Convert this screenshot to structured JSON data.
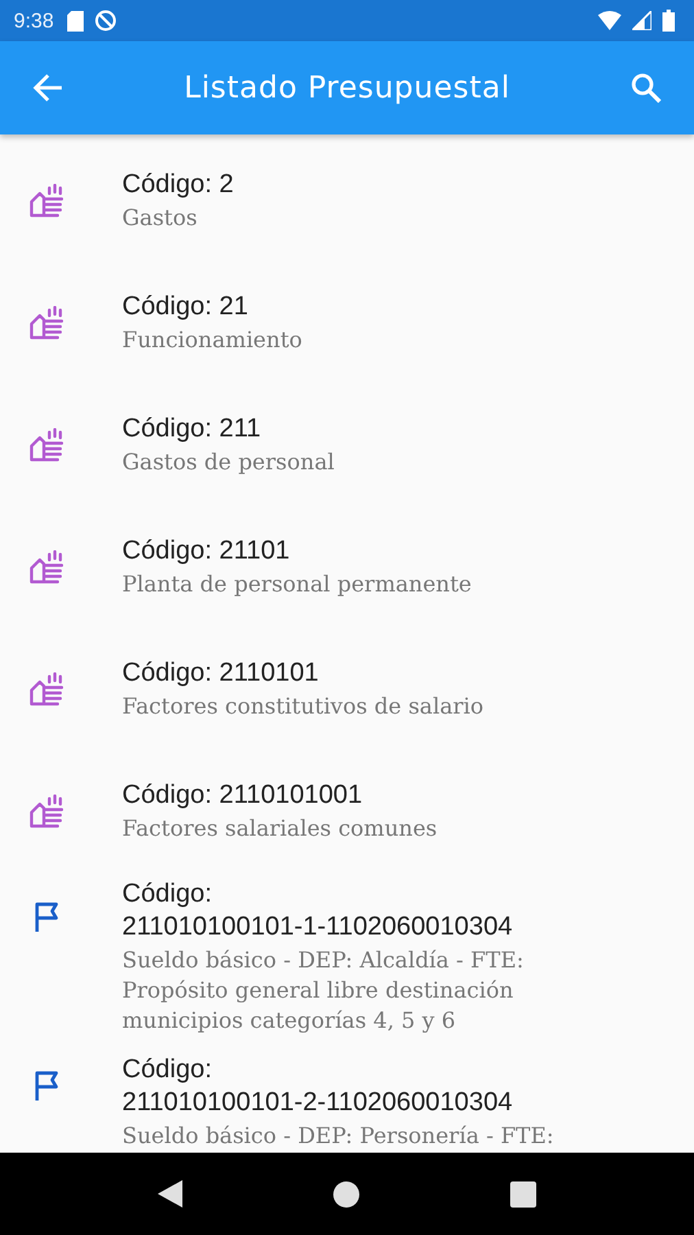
{
  "status_bar": {
    "time": "9:38"
  },
  "app_bar": {
    "title": "Listado Presupuestal"
  },
  "items": [
    {
      "kind": "group",
      "label": "Código:",
      "code": "2",
      "subtitle": "Gastos"
    },
    {
      "kind": "group",
      "label": "Código:",
      "code": "21",
      "subtitle": "Funcionamiento"
    },
    {
      "kind": "group",
      "label": "Código:",
      "code": "211",
      "subtitle": "Gastos de personal"
    },
    {
      "kind": "group",
      "label": "Código:",
      "code": "21101",
      "subtitle": "Planta de personal permanente"
    },
    {
      "kind": "group",
      "label": "Código:",
      "code": "2110101",
      "subtitle": "Factores constitutivos de salario"
    },
    {
      "kind": "group",
      "label": "Código:",
      "code": "2110101001",
      "subtitle": "Factores salariales comunes"
    },
    {
      "kind": "leaf",
      "label": "Código:",
      "code": "211010100101-1-1102060010304",
      "subtitle": "Sueldo básico - DEP: Alcaldía - FTE: Propósito general libre destinación municipios categorías 4, 5 y 6"
    },
    {
      "kind": "leaf",
      "label": "Código:",
      "code": "211010100101-2-1102060010304",
      "subtitle": "Sueldo básico - DEP: Personería - FTE:"
    }
  ]
}
